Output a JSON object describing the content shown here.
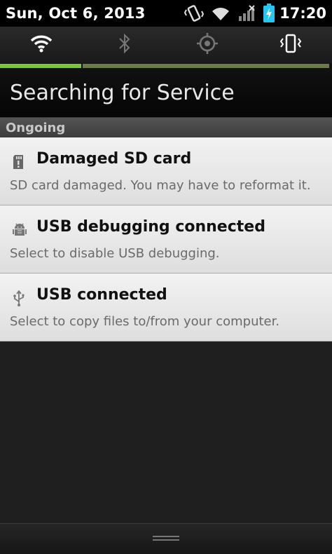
{
  "status_bar": {
    "date": "Sun, Oct 6, 2013",
    "time": "17:20",
    "icons": [
      "vibrate-icon",
      "wifi-icon",
      "no-signal-icon",
      "battery-charging-icon"
    ]
  },
  "quick_toggles": {
    "items": [
      "wifi-toggle-icon",
      "bluetooth-toggle-icon",
      "gps-toggle-icon",
      "sound-vibrate-toggle-icon"
    ]
  },
  "carrier": {
    "label": "Searching for Service"
  },
  "section": {
    "label": "Ongoing"
  },
  "notifications": [
    {
      "icon": "sd-card-icon",
      "title": "Damaged SD card",
      "text": "SD card damaged. You may have to reformat it."
    },
    {
      "icon": "android-debug-icon",
      "title": "USB debugging connected",
      "text": "Select to disable USB debugging."
    },
    {
      "icon": "usb-icon",
      "title": "USB connected",
      "text": "Select to copy files to/from your computer."
    }
  ],
  "colors": {
    "toggle_on": "#7fc241",
    "toggle_off": "#6b7a4a",
    "battery": "#26c6f0"
  }
}
